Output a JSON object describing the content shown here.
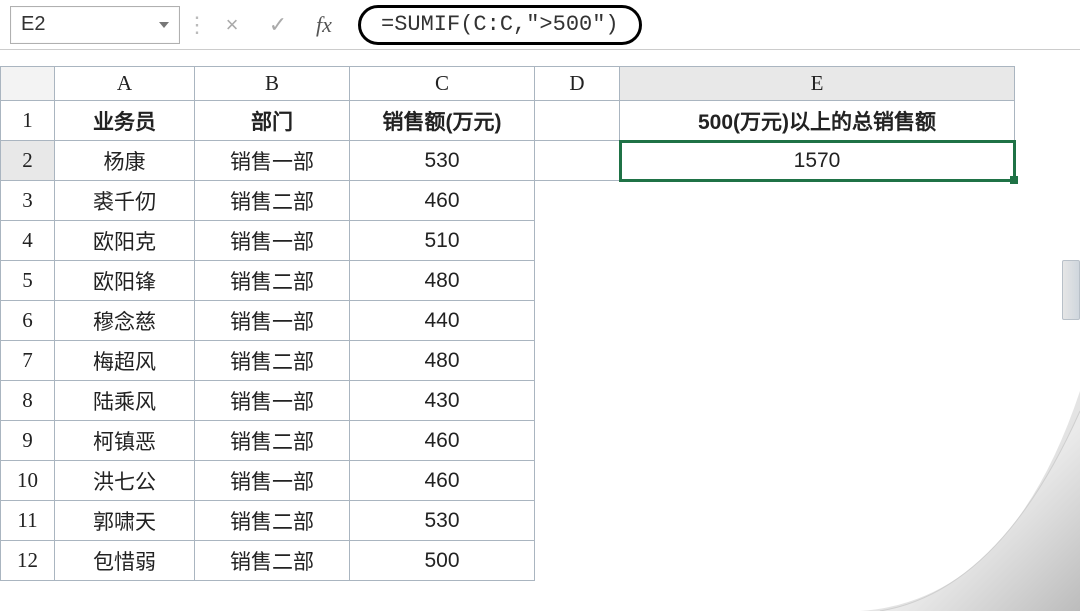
{
  "nameBox": "E2",
  "formulaBarButtons": {
    "cancel": "×",
    "enter": "✓",
    "fx": "fx"
  },
  "formula": "=SUMIF(C:C,\">500\")",
  "columnHeaders": {
    "A": "A",
    "B": "B",
    "C": "C",
    "D": "D",
    "E": "E"
  },
  "rowNumbers": [
    "1",
    "2",
    "3",
    "4",
    "5",
    "6",
    "7",
    "8",
    "9",
    "10",
    "11",
    "12"
  ],
  "headers": {
    "A": "业务员",
    "B": "部门",
    "C": "销售额(万元)",
    "E": "500(万元)以上的总销售额"
  },
  "result": "1570",
  "rows": [
    {
      "name": "杨康",
      "dept": "销售一部",
      "sales": "530",
      "hi": true
    },
    {
      "name": "裘千仞",
      "dept": "销售二部",
      "sales": "460",
      "hi": false
    },
    {
      "name": "欧阳克",
      "dept": "销售一部",
      "sales": "510",
      "hi": true
    },
    {
      "name": "欧阳锋",
      "dept": "销售二部",
      "sales": "480",
      "hi": false
    },
    {
      "name": "穆念慈",
      "dept": "销售一部",
      "sales": "440",
      "hi": false
    },
    {
      "name": "梅超风",
      "dept": "销售二部",
      "sales": "480",
      "hi": false
    },
    {
      "name": "陆乘风",
      "dept": "销售一部",
      "sales": "430",
      "hi": false
    },
    {
      "name": "柯镇恶",
      "dept": "销售二部",
      "sales": "460",
      "hi": false
    },
    {
      "name": "洪七公",
      "dept": "销售一部",
      "sales": "460",
      "hi": false
    },
    {
      "name": "郭啸天",
      "dept": "销售二部",
      "sales": "530",
      "hi": true
    },
    {
      "name": "包惜弱",
      "dept": "销售二部",
      "sales": "500",
      "hi": false
    }
  ],
  "chart_data": {
    "type": "table",
    "title": "销售额(万元)",
    "columns": [
      "业务员",
      "部门",
      "销售额(万元)"
    ],
    "rows": [
      [
        "杨康",
        "销售一部",
        530
      ],
      [
        "裘千仞",
        "销售二部",
        460
      ],
      [
        "欧阳克",
        "销售一部",
        510
      ],
      [
        "欧阳锋",
        "销售二部",
        480
      ],
      [
        "穆念慈",
        "销售一部",
        440
      ],
      [
        "梅超风",
        "销售二部",
        480
      ],
      [
        "陆乘风",
        "销售一部",
        430
      ],
      [
        "柯镇恶",
        "销售二部",
        460
      ],
      [
        "洪七公",
        "销售一部",
        460
      ],
      [
        "郭啸天",
        "销售二部",
        530
      ],
      [
        "包惜弱",
        "销售二部",
        500
      ]
    ],
    "derived": {
      "label": "500(万元)以上的总销售额",
      "value": 1570
    }
  }
}
